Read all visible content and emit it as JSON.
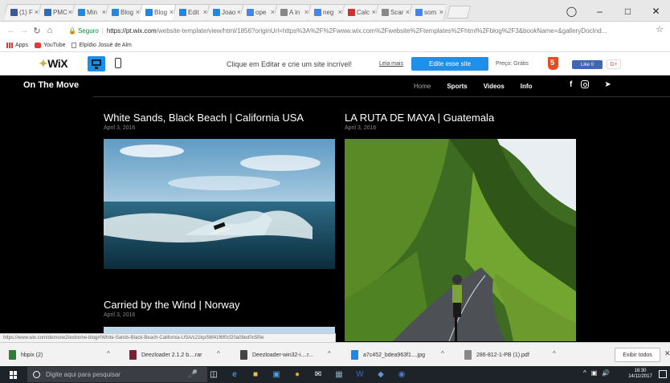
{
  "browser": {
    "tabs": [
      {
        "label": "(1) F",
        "color": "#3b5998"
      },
      {
        "label": "PMC",
        "color": "#2a6ebb"
      },
      {
        "label": "Min",
        "color": "#1e88e5"
      },
      {
        "label": "Blog",
        "color": "#1e88e5"
      },
      {
        "label": "Blog",
        "color": "#1e88e5"
      },
      {
        "label": "Edit",
        "color": "#1e88e5"
      },
      {
        "label": "Joao",
        "color": "#1e88e5"
      },
      {
        "label": "ope",
        "color": "#4285f4"
      },
      {
        "label": "A in",
        "color": "#888888"
      },
      {
        "label": "neg",
        "color": "#4285f4"
      },
      {
        "label": "Calc",
        "color": "#d32f2f"
      },
      {
        "label": "Scar",
        "color": "#888888"
      },
      {
        "label": "som",
        "color": "#4285f4"
      }
    ],
    "secure_label": "Seguro",
    "url_host": "https://pt.wix.com",
    "url_path": "/website-template/view/html/1856?originUrl=https%3A%2F%2Fwww.wix.com%2Fwebsite%2Ftemplates%2Fhtml%2Fblog%2F3&bookName=&galleryDocInd...",
    "bookmarks": [
      "Apps",
      "YouTube",
      "Elpídio Josué de Alm"
    ]
  },
  "wix_bar": {
    "logo": "WiX",
    "promo_text": "Clique em Editar e crie um site incrível!",
    "learn_more": "Leia mais",
    "edit_button": "Edite esse site",
    "price": "Preço: Grátis",
    "fb_like": "Like 0",
    "gplus": "G+"
  },
  "site": {
    "title": "On The Move",
    "nav": [
      "Home",
      "Sports",
      "Videos",
      "Info"
    ],
    "posts": [
      {
        "title": "White Sands, Black Beach | California USA",
        "date": "April 3, 2016"
      },
      {
        "title": "LA RUTA DE MAYA | Guatemala",
        "date": "April 3, 2016"
      },
      {
        "title": "Carried by the Wind | Norway",
        "date": "April 3, 2016"
      }
    ]
  },
  "status_url": "https://www.wix.com/demone2/extreme-blog#!White-Sands-Black-Beach-California-USA/c21kp/56f41f6f0cf20a08ed0c5f0e",
  "downloads": {
    "items": [
      {
        "name": "hbpix (2)",
        "color": "#2e7d32"
      },
      {
        "name": "Deezloader 2.1.2 b....rar",
        "color": "#7b1f3a"
      },
      {
        "name": "Deezloader-win32-i....r...",
        "color": "#444444"
      },
      {
        "name": "a7c452_bdea963f1....jpg",
        "color": "#1e88e5"
      },
      {
        "name": "286-812-1-PB (1).pdf",
        "color": "#888888"
      }
    ],
    "show_all": "Exibir todos"
  },
  "taskbar": {
    "search_placeholder": "Digite aqui para pesquisar",
    "time": "18:30",
    "date": "14/11/2017"
  }
}
